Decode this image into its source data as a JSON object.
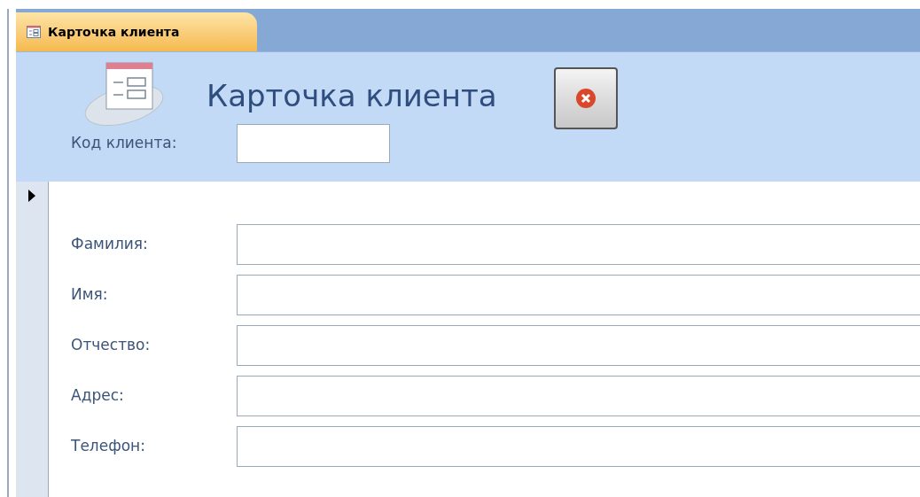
{
  "tab": {
    "label": "Карточка клиента",
    "selected": true
  },
  "header": {
    "title": "Карточка клиента",
    "code_label": "Код клиента:"
  },
  "fields": [
    {
      "label": "Фамилия:"
    },
    {
      "label": "Имя:"
    },
    {
      "label": "Отчество:"
    },
    {
      "label": "Адрес:"
    },
    {
      "label": "Телефон:"
    }
  ]
}
